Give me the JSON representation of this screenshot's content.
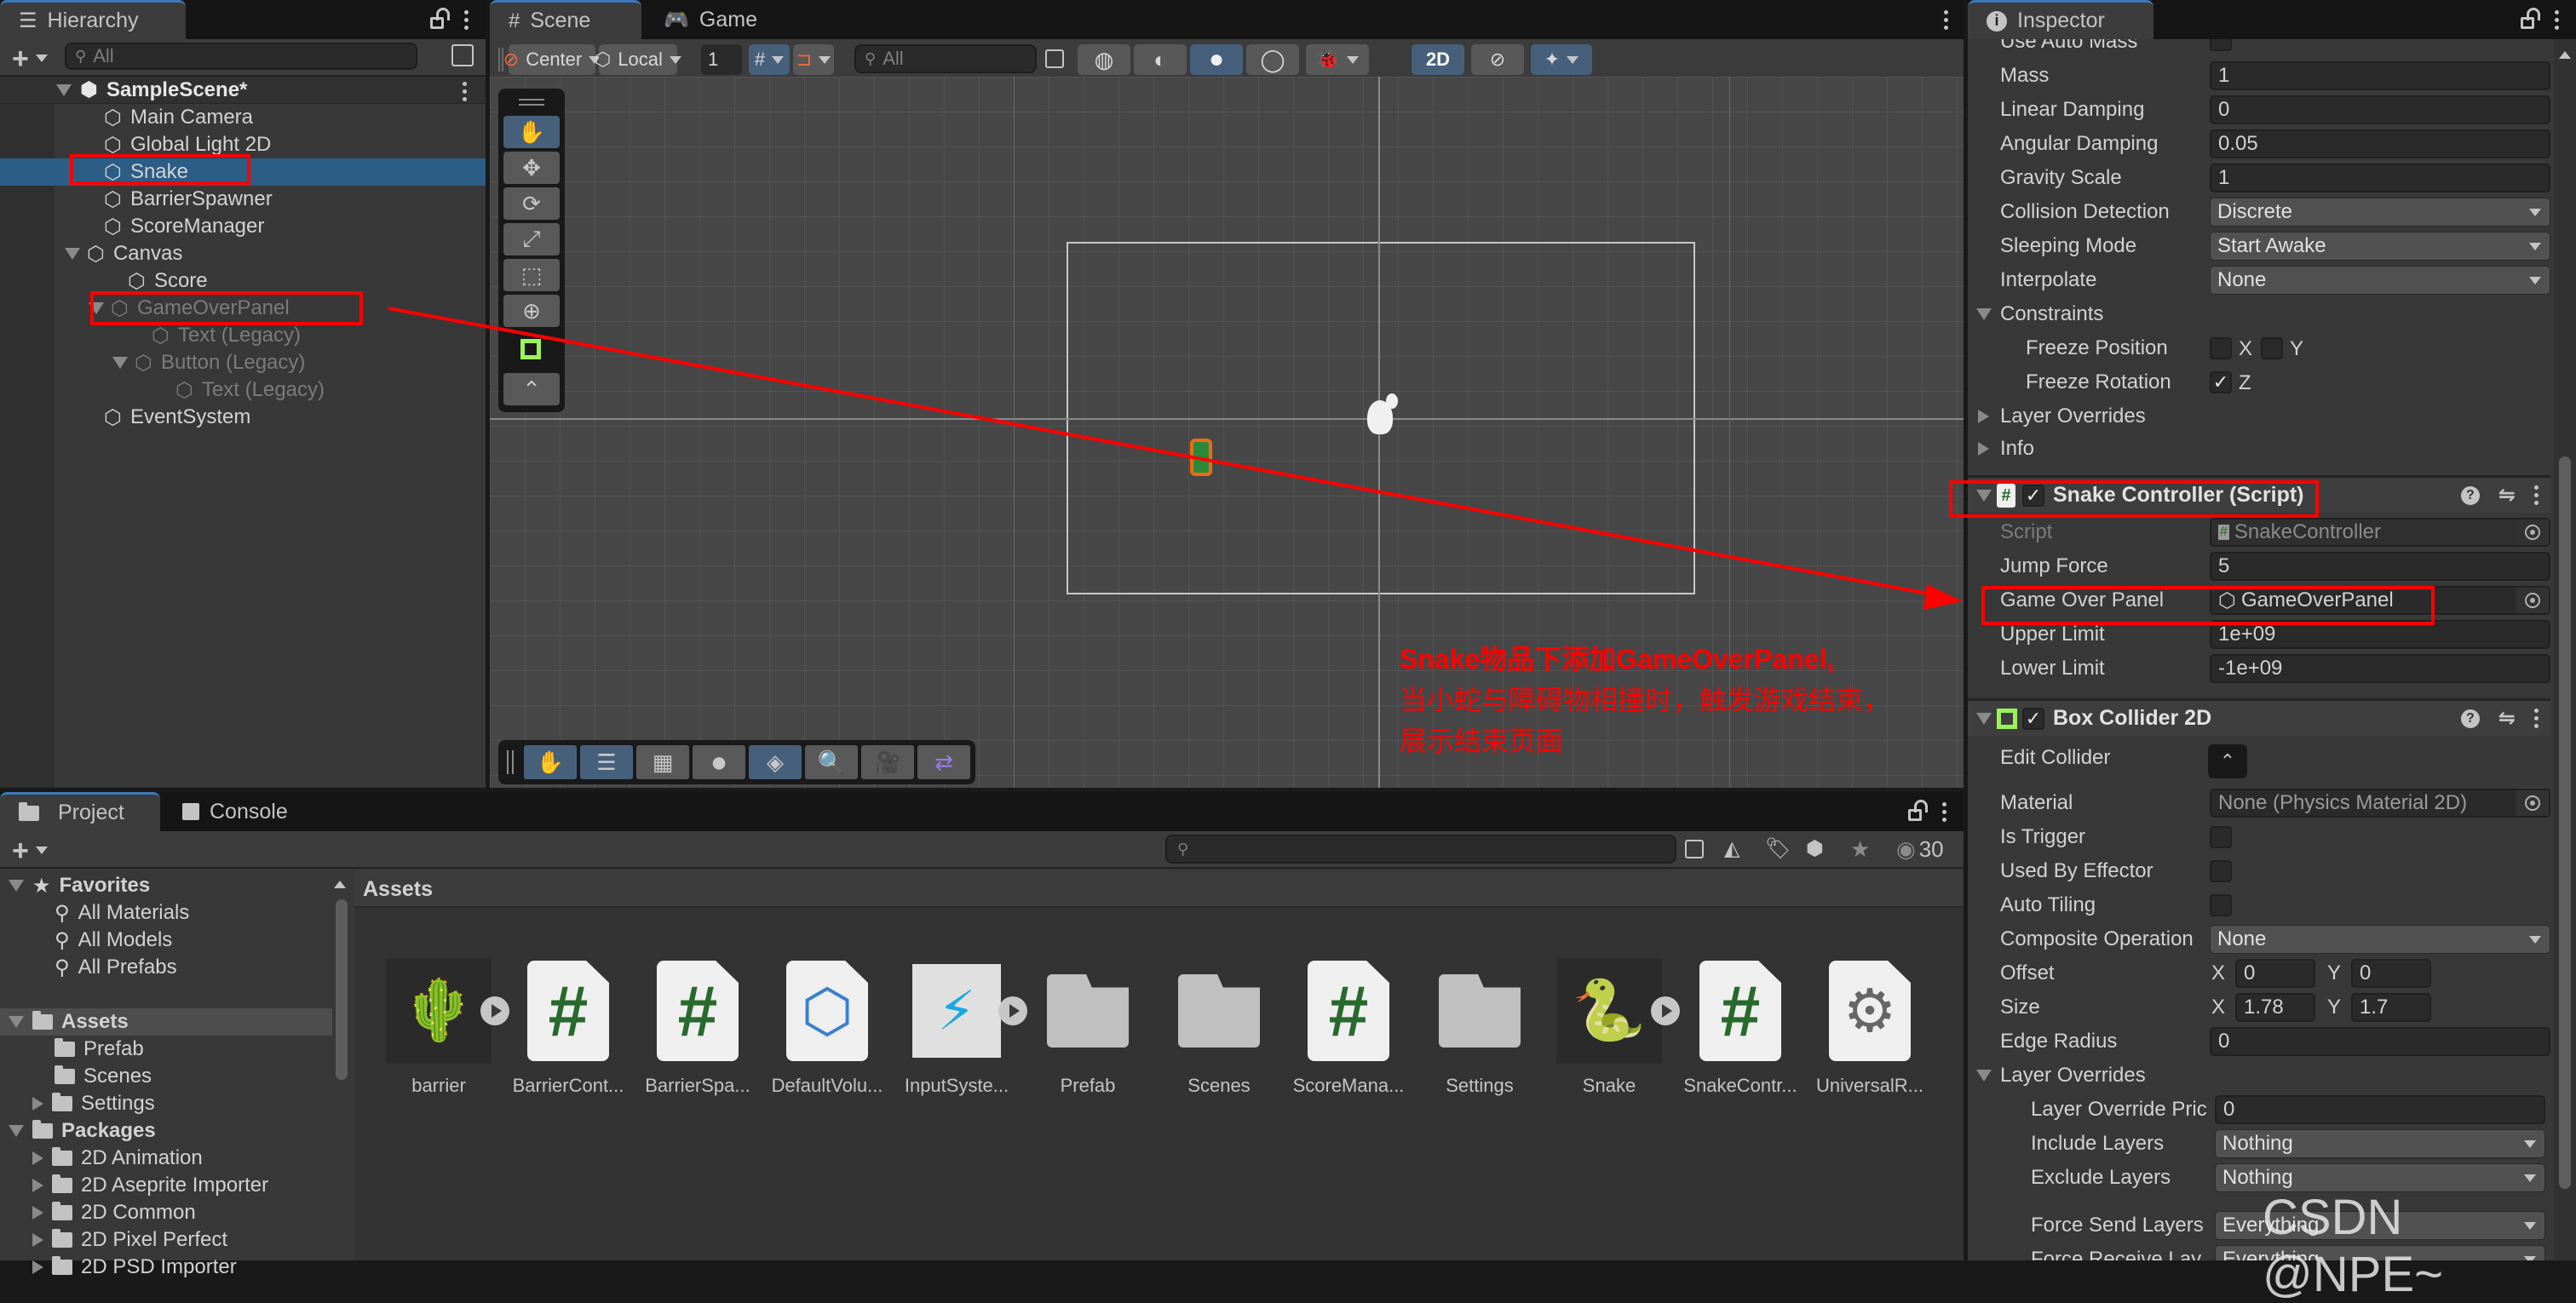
{
  "hierarchy": {
    "tab_label": "Hierarchy",
    "search_placeholder": "All",
    "scene_name": "SampleScene*",
    "items": [
      {
        "label": "Main Camera",
        "depth": 1,
        "state": "normal"
      },
      {
        "label": "Global Light 2D",
        "depth": 1,
        "state": "normal"
      },
      {
        "label": "Snake",
        "depth": 1,
        "state": "selected"
      },
      {
        "label": "BarrierSpawner",
        "depth": 1,
        "state": "normal"
      },
      {
        "label": "ScoreManager",
        "depth": 1,
        "state": "normal"
      },
      {
        "label": "Canvas",
        "depth": 1,
        "state": "expanded"
      },
      {
        "label": "Score",
        "depth": 2,
        "state": "normal"
      },
      {
        "label": "GameOverPanel",
        "depth": 2,
        "state": "inactive-expanded"
      },
      {
        "label": "Text (Legacy)",
        "depth": 3,
        "state": "inactive"
      },
      {
        "label": "Button (Legacy)",
        "depth": 3,
        "state": "inactive-expanded"
      },
      {
        "label": "Text (Legacy)",
        "depth": 4,
        "state": "inactive"
      },
      {
        "label": "EventSystem",
        "depth": 1,
        "state": "normal"
      }
    ]
  },
  "scene": {
    "tabs": [
      {
        "label": "Scene",
        "active": true
      },
      {
        "label": "Game",
        "active": false
      }
    ],
    "toolbar": {
      "pivot_mode": "Center",
      "pivot_rotation": "Local",
      "grid_snap_value": "1",
      "search_placeholder": "All",
      "mode_2d_label": "2D"
    },
    "tools_vertical": [
      "hand-tool",
      "move-tool",
      "rotate-tool",
      "scale-tool",
      "rect-tool",
      "transform-tool",
      "collider-gizmo",
      "edit-collider-tool"
    ],
    "tools_horizontal": [
      "hand-tool",
      "overlays-toggle",
      "grid-toggle",
      "shading-mode",
      "component-tools",
      "search-tool",
      "camera-view",
      "navigation-toggle"
    ],
    "annotation": {
      "line1": "Snake物品下添加GameOverPanel,",
      "line2": "当小蛇与障碍物相撞时，触发游戏结束，",
      "line3": "展示结束页面"
    }
  },
  "inspector": {
    "tab_label": "Inspector",
    "rigidbody_rows": [
      {
        "label": "Use Auto Mass",
        "type": "checkbox",
        "checked": false
      },
      {
        "label": "Mass",
        "type": "number",
        "value": "1"
      },
      {
        "label": "Linear Damping",
        "type": "number",
        "value": "0"
      },
      {
        "label": "Angular Damping",
        "type": "number",
        "value": "0.05"
      },
      {
        "label": "Gravity Scale",
        "type": "number",
        "value": "1"
      },
      {
        "label": "Collision Detection",
        "type": "dropdown",
        "value": "Discrete"
      },
      {
        "label": "Sleeping Mode",
        "type": "dropdown",
        "value": "Start Awake"
      },
      {
        "label": "Interpolate",
        "type": "dropdown",
        "value": "None"
      }
    ],
    "constraints": {
      "label": "Constraints",
      "freeze_position": {
        "label": "Freeze Position",
        "x": false,
        "y": false,
        "x_label": "X",
        "y_label": "Y"
      },
      "freeze_rotation": {
        "label": "Freeze Rotation",
        "z": true,
        "z_label": "Z"
      }
    },
    "layer_overrides_label": "Layer Overrides",
    "info_label": "Info",
    "snake_controller": {
      "title": "Snake Controller (Script)",
      "enabled": true,
      "script_label": "Script",
      "script_value": "SnakeController",
      "jump_force_label": "Jump Force",
      "jump_force": "5",
      "game_over_panel_label": "Game Over Panel",
      "game_over_panel_value": "GameOverPanel",
      "upper_limit_label": "Upper Limit",
      "upper_limit": "1e+09",
      "lower_limit_label": "Lower Limit",
      "lower_limit": "-1e+09"
    },
    "box_collider": {
      "title": "Box Collider 2D",
      "enabled": true,
      "edit_collider_label": "Edit Collider",
      "material_label": "Material",
      "material_value": "None (Physics Material 2D)",
      "is_trigger_label": "Is Trigger",
      "used_by_effector_label": "Used By Effector",
      "auto_tiling_label": "Auto Tiling",
      "composite_label": "Composite Operation",
      "composite_value": "None",
      "offset_label": "Offset",
      "offset_x": "0",
      "offset_y": "0",
      "size_label": "Size",
      "size_x": "1.78",
      "size_y": "1.7",
      "edge_radius_label": "Edge Radius",
      "edge_radius": "0",
      "layer_overrides_label": "Layer Overrides",
      "layer_override_priority_label": "Layer Override Pric",
      "layer_override_priority": "0",
      "include_layers_label": "Include Layers",
      "include_layers": "Nothing",
      "exclude_layers_label": "Exclude Layers",
      "exclude_layers": "Nothing",
      "force_send_label": "Force Send Layers",
      "force_send": "Everything",
      "force_receive_label": "Force Receive Lay",
      "force_receive": "Everything",
      "x_label": "X",
      "y_label": "Y"
    }
  },
  "project": {
    "tabs": [
      {
        "label": "Project",
        "active": true
      },
      {
        "label": "Console",
        "active": false
      }
    ],
    "visible_count": "30",
    "favorites": {
      "label": "Favorites",
      "items": [
        "All Materials",
        "All Models",
        "All Prefabs"
      ]
    },
    "assets_tree": {
      "label": "Assets",
      "items": [
        "Prefab",
        "Scenes",
        "Settings"
      ]
    },
    "packages": {
      "label": "Packages",
      "items": [
        "2D Animation",
        "2D Aseprite Importer",
        "2D Common",
        "2D Pixel Perfect",
        "2D PSD Importer"
      ]
    },
    "breadcrumb": "Assets",
    "assets": [
      {
        "name": "barrier",
        "kind": "prefab-sprite"
      },
      {
        "name": "BarrierCont...",
        "kind": "script"
      },
      {
        "name": "BarrierSpa...",
        "kind": "script"
      },
      {
        "name": "DefaultVolu...",
        "kind": "volume-profile"
      },
      {
        "name": "InputSyste...",
        "kind": "input-actions"
      },
      {
        "name": "Prefab",
        "kind": "folder"
      },
      {
        "name": "Scenes",
        "kind": "folder"
      },
      {
        "name": "ScoreMana...",
        "kind": "script"
      },
      {
        "name": "Settings",
        "kind": "folder"
      },
      {
        "name": "Snake",
        "kind": "prefab-sprite"
      },
      {
        "name": "SnakeContr...",
        "kind": "script"
      },
      {
        "name": "UniversalR...",
        "kind": "render-pipeline-asset"
      }
    ]
  },
  "watermark": "CSDN @NPE~",
  "colors": {
    "annotation": "#ff0000",
    "selection": "#2c5d87",
    "toolbar_active": "#46607c",
    "script_hash": "#276a2b"
  }
}
